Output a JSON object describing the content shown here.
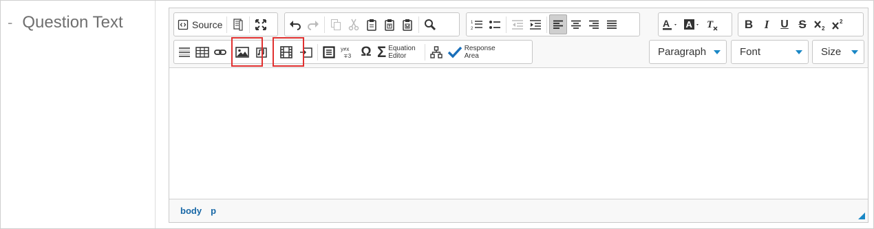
{
  "field": {
    "dash": "-",
    "label": "Question Text"
  },
  "toolbar": {
    "source_label": "Source",
    "equation_editor_label_1": "Equation",
    "equation_editor_label_2": "Editor",
    "response_area_label_1": "Response",
    "response_area_label_2": "Area",
    "format_dropdown": "Paragraph",
    "font_dropdown": "Font",
    "size_dropdown": "Size",
    "icons": [
      "source-icon",
      "template-icon",
      "maximize-icon",
      "undo-icon",
      "redo-icon",
      "copy-icon",
      "cut-icon",
      "paste-icon",
      "paste-text-icon",
      "paste-word-icon",
      "find-icon",
      "numbered-list-icon",
      "bulleted-list-icon",
      "outdent-icon",
      "indent-icon",
      "align-left-icon",
      "align-center-icon",
      "align-right-icon",
      "justify-icon",
      "text-color-icon",
      "background-color-icon",
      "remove-format-icon",
      "bold-icon",
      "italic-icon",
      "underline-icon",
      "strikethrough-icon",
      "subscript-icon",
      "superscript-icon",
      "horizontal-rule-icon",
      "table-icon",
      "link-icon",
      "image-icon",
      "audio-icon",
      "video-icon",
      "embed-icon",
      "div-icon",
      "math-icon",
      "special-char-icon",
      "sigma-icon",
      "hierarchy-icon",
      "checkmark-icon"
    ],
    "highlight_color": "#e0302f",
    "accent_color": "#1a87c5"
  },
  "statusbar": {
    "path": [
      "body",
      "p"
    ]
  }
}
